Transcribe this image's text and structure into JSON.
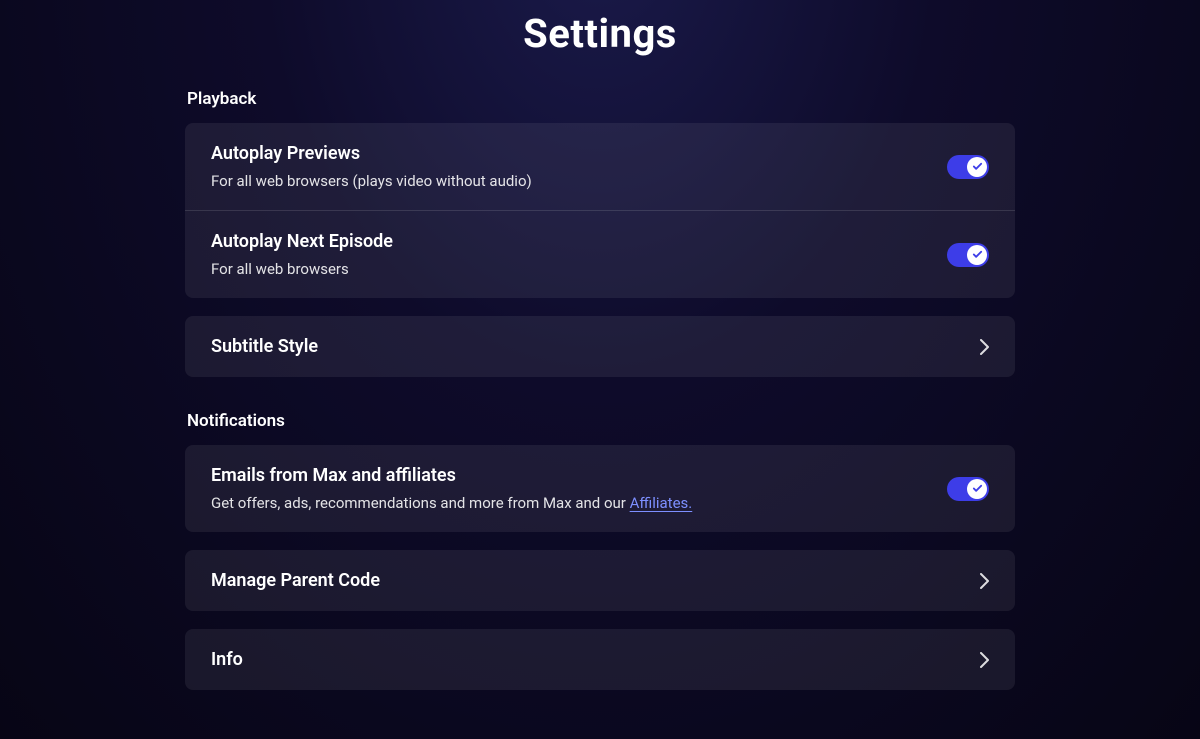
{
  "page_title": "Settings",
  "sections": {
    "playback": {
      "label": "Playback",
      "autoplay_previews": {
        "title": "Autoplay Previews",
        "desc": "For all web browsers (plays video without audio)",
        "enabled": true
      },
      "autoplay_next": {
        "title": "Autoplay Next Episode",
        "desc": "For all web browsers",
        "enabled": true
      },
      "subtitle_style": {
        "title": "Subtitle Style"
      }
    },
    "notifications": {
      "label": "Notifications",
      "emails": {
        "title": "Emails from Max and affiliates",
        "desc_prefix": "Get offers, ads, recommendations and more from Max and our ",
        "link_text": "Affiliates.",
        "enabled": true
      }
    },
    "manage_parent_code": {
      "title": "Manage Parent Code"
    },
    "info": {
      "title": "Info"
    }
  },
  "colors": {
    "toggle_on": "#3d3de8",
    "link": "#7d8fff"
  }
}
